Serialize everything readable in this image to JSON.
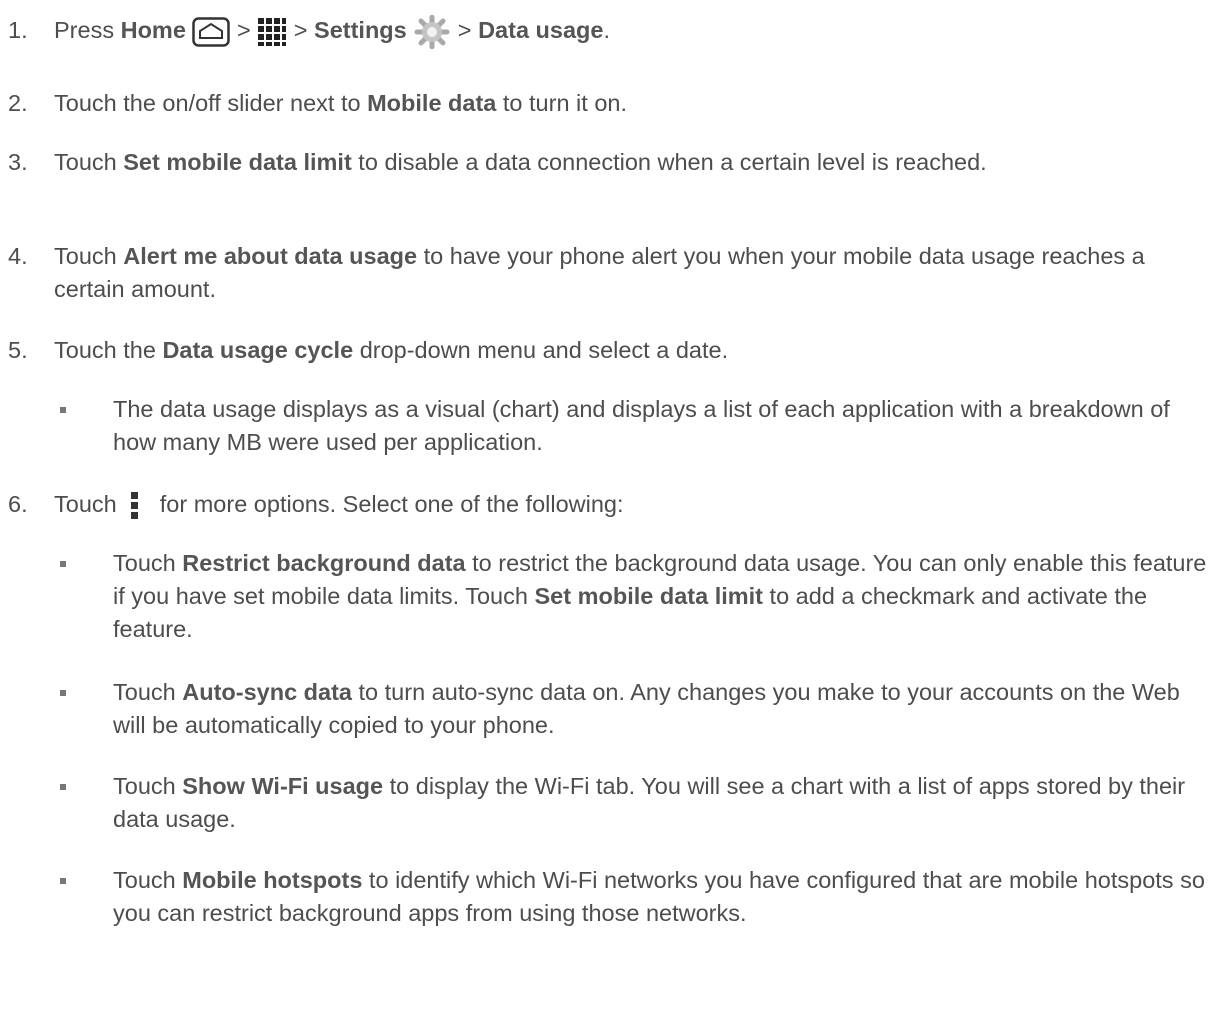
{
  "steps": [
    {
      "n": "1.",
      "parts": [
        "Press ",
        "Home",
        " > ",
        " > ",
        "Settings",
        " > ",
        "Data usage",
        "."
      ]
    },
    {
      "n": "2.",
      "parts": [
        "Touch the on/off slider next to ",
        "Mobile data",
        " to turn it on."
      ]
    },
    {
      "n": "3.",
      "parts": [
        "Touch ",
        "Set mobile data limit",
        " to disable a data connection when a certain level is reached."
      ]
    },
    {
      "n": "4.",
      "parts": [
        "Touch ",
        "Alert me about data usage",
        " to have your phone alert you when your mobile data usage reaches a certain amount."
      ]
    },
    {
      "n": "5.",
      "parts": [
        "Touch the ",
        "Data usage cycle",
        " drop-down menu and select a date."
      ]
    },
    {
      "n": "6.",
      "parts": [
        "Touch ",
        " for more options. Select one of the following:"
      ]
    }
  ],
  "step5_bullet": "The data usage displays as a visual (chart) and displays a list of each application with a breakdown of how many MB were used per application.",
  "step6_bullets": [
    {
      "parts": [
        "Touch ",
        "Restrict background data",
        " to restrict the background data usage. You can only enable this feature if you have set mobile data limits. Touch ",
        "Set mobile data limit",
        " to add a checkmark and activate the feature."
      ]
    },
    {
      "parts": [
        "Touch ",
        "Auto-sync data",
        " to turn auto-sync data on. Any changes you make to your accounts on the Web will be automatically copied to your phone."
      ]
    },
    {
      "parts": [
        "Touch ",
        "Show Wi-Fi usage",
        " to display the Wi-Fi tab. You will see a chart with a list of apps stored by their data usage."
      ]
    },
    {
      "parts": [
        "Touch ",
        "Mobile hotspots",
        " to identify which Wi-Fi networks you have configured that are mobile hotspots so you can restrict background apps from using those networks."
      ]
    }
  ]
}
